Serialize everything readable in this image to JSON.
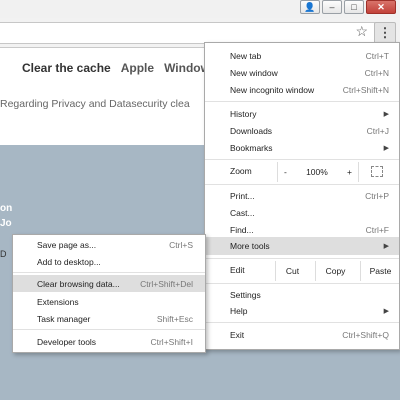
{
  "window": {
    "minimize": "–",
    "maximize": "□",
    "close": "✕",
    "user_icon": "👤"
  },
  "toolbar": {
    "star_icon": "☆",
    "menu_icon": "⋮"
  },
  "page": {
    "nav": [
      "Clear the cache",
      "Apple",
      "Windows"
    ],
    "subtext": "Regarding Privacy and Datasecurity clea",
    "hero_lines": [
      "on",
      "Jo"
    ]
  },
  "menu": {
    "new_tab": {
      "label": "New tab",
      "shortcut": "Ctrl+T"
    },
    "new_window": {
      "label": "New window",
      "shortcut": "Ctrl+N"
    },
    "new_incognito": {
      "label": "New incognito window",
      "shortcut": "Ctrl+Shift+N"
    },
    "history": {
      "label": "History"
    },
    "downloads": {
      "label": "Downloads",
      "shortcut": "Ctrl+J"
    },
    "bookmarks": {
      "label": "Bookmarks"
    },
    "zoom": {
      "label": "Zoom",
      "minus": "-",
      "value": "100%",
      "plus": "+"
    },
    "print": {
      "label": "Print...",
      "shortcut": "Ctrl+P"
    },
    "cast": {
      "label": "Cast..."
    },
    "find": {
      "label": "Find...",
      "shortcut": "Ctrl+F"
    },
    "more_tools": {
      "label": "More tools"
    },
    "edit": {
      "label": "Edit",
      "cut": "Cut",
      "copy": "Copy",
      "paste": "Paste"
    },
    "settings": {
      "label": "Settings"
    },
    "help": {
      "label": "Help"
    },
    "exit": {
      "label": "Exit",
      "shortcut": "Ctrl+Shift+Q"
    }
  },
  "submenu": {
    "save_page": {
      "label": "Save page as...",
      "shortcut": "Ctrl+S"
    },
    "add_desktop": {
      "label": "Add to desktop..."
    },
    "clear_browsing": {
      "label": "Clear browsing data...",
      "shortcut": "Ctrl+Shift+Del"
    },
    "extensions": {
      "label": "Extensions"
    },
    "task_manager": {
      "label": "Task manager",
      "shortcut": "Shift+Esc"
    },
    "dev_tools": {
      "label": "Developer tools",
      "shortcut": "Ctrl+Shift+I"
    }
  },
  "left_edge_text": "D"
}
